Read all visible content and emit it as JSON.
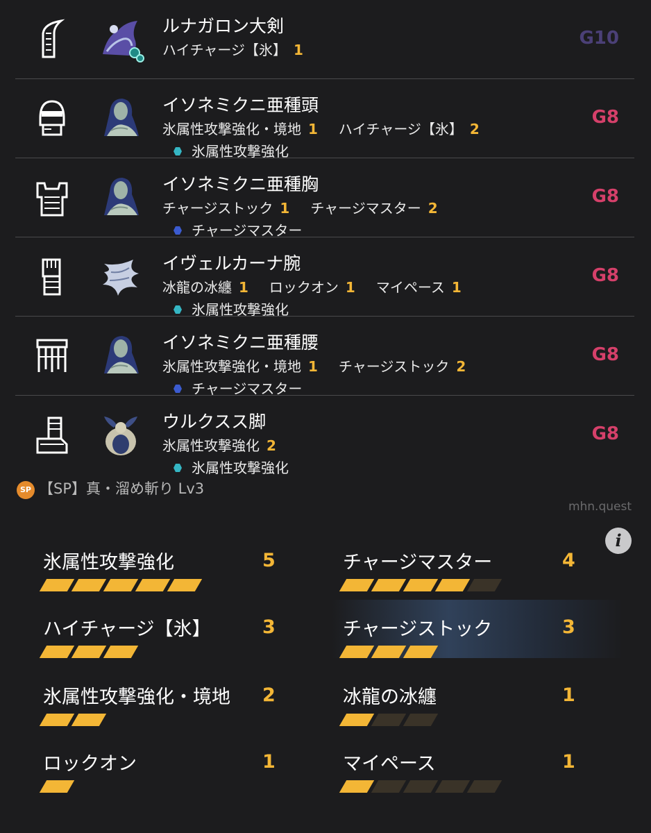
{
  "equipment": [
    {
      "slot": "weapon",
      "slot_icon": "great-sword-icon",
      "monster": "lunagaron",
      "name": "ルナガロン大剣",
      "skills": [
        {
          "name": "ハイチャージ【氷】",
          "level": "1"
        }
      ],
      "series": null,
      "grade": "G10"
    },
    {
      "slot": "head",
      "slot_icon": "helmet-icon",
      "monster": "isonemikuni",
      "name": "イソネミクニ亜種頭",
      "skills": [
        {
          "name": "氷属性攻撃強化・境地",
          "level": "1"
        },
        {
          "name": "ハイチャージ【氷】",
          "level": "2"
        }
      ],
      "series": {
        "name": "氷属性攻撃強化",
        "color": "#35b6c4"
      },
      "grade": "G8"
    },
    {
      "slot": "chest",
      "slot_icon": "chest-armor-icon",
      "monster": "isonemikuni",
      "name": "イソネミクニ亜種胸",
      "skills": [
        {
          "name": "チャージストック",
          "level": "1"
        },
        {
          "name": "チャージマスター",
          "level": "2"
        }
      ],
      "series": {
        "name": "チャージマスター",
        "color": "#3b5bd0"
      },
      "grade": "G8"
    },
    {
      "slot": "arms",
      "slot_icon": "gauntlet-icon",
      "monster": "velkhana",
      "name": "イヴェルカーナ腕",
      "skills": [
        {
          "name": "冰龍の冰纏",
          "level": "1"
        },
        {
          "name": "ロックオン",
          "level": "1"
        },
        {
          "name": "マイペース",
          "level": "1"
        }
      ],
      "series": {
        "name": "氷属性攻撃強化",
        "color": "#35b6c4"
      },
      "grade": "G8"
    },
    {
      "slot": "waist",
      "slot_icon": "waist-armor-icon",
      "monster": "isonemikuni",
      "name": "イソネミクニ亜種腰",
      "skills": [
        {
          "name": "氷属性攻撃強化・境地",
          "level": "1"
        },
        {
          "name": "チャージストック",
          "level": "2"
        }
      ],
      "series": {
        "name": "チャージマスター",
        "color": "#3b5bd0"
      },
      "grade": "G8"
    },
    {
      "slot": "legs",
      "slot_icon": "boots-icon",
      "monster": "ulque",
      "name": "ウルクスス脚",
      "skills": [
        {
          "name": "氷属性攻撃強化",
          "level": "2"
        }
      ],
      "series": {
        "name": "氷属性攻撃強化",
        "color": "#35b6c4"
      },
      "grade": "G8"
    }
  ],
  "sp_skill": {
    "badge": "SP",
    "text": "【SP】真・溜め斬り Lv3"
  },
  "site": "mhn.quest",
  "info_icon": "i",
  "skill_summary": [
    {
      "name": "氷属性攻撃強化",
      "level": "5",
      "max": 5
    },
    {
      "name": "チャージマスター",
      "level": "4",
      "max": 5
    },
    {
      "name": "ハイチャージ【氷】",
      "level": "3",
      "max": 3
    },
    {
      "name": "チャージストック",
      "level": "3",
      "max": 3
    },
    {
      "name": "氷属性攻撃強化・境地",
      "level": "2",
      "max": 2
    },
    {
      "name": "冰龍の冰纏",
      "level": "1",
      "max": 3
    },
    {
      "name": "ロックオン",
      "level": "1",
      "max": 1
    },
    {
      "name": "マイペース",
      "level": "1",
      "max": 5
    }
  ],
  "colors": {
    "accent": "#f3b636",
    "grade_g8": "#d5406a",
    "grade_g10": "#4b4077",
    "background": "#1c1c1e"
  }
}
